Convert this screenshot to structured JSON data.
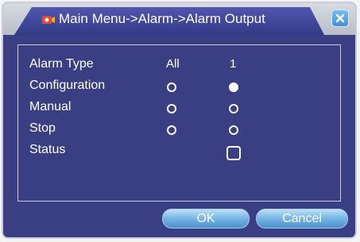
{
  "window": {
    "title": "Main Menu->Alarm->Alarm Output"
  },
  "table": {
    "column_headers": [
      "All",
      "1"
    ],
    "rows": [
      {
        "label": "Alarm Type"
      },
      {
        "label": "Configuration",
        "all_selected": false,
        "ch1_selected": true
      },
      {
        "label": "Manual",
        "all_selected": false,
        "ch1_selected": false
      },
      {
        "label": "Stop",
        "all_selected": false,
        "ch1_selected": false
      },
      {
        "label": "Status",
        "ch1_checked": false
      }
    ]
  },
  "buttons": {
    "ok_label": "OK",
    "cancel_label": "Cancel"
  },
  "colors": {
    "background": "#3a3f83",
    "accent": "#4a8fcd"
  },
  "icons": [
    "camera-icon",
    "close-icon"
  ]
}
